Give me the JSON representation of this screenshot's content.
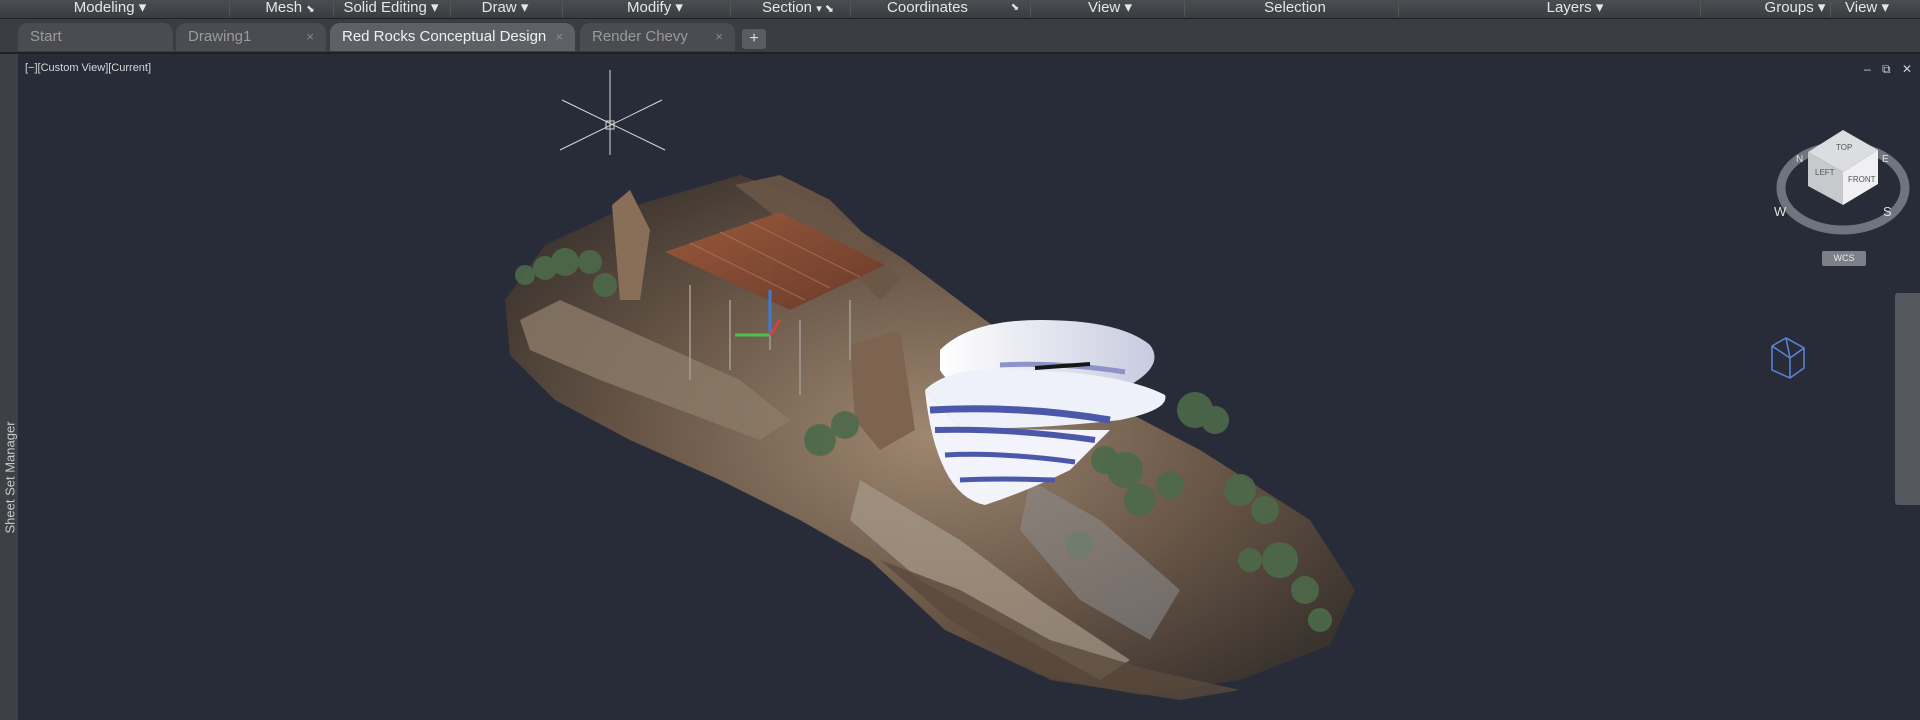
{
  "ribbon": [
    {
      "label": "Modeling",
      "arrow": "▾"
    },
    {
      "label": "Mesh",
      "arrow": "⬊"
    },
    {
      "label": "Solid Editing",
      "arrow": "▾"
    },
    {
      "label": "Draw",
      "arrow": "▾"
    },
    {
      "label": "Modify",
      "arrow": "▾"
    },
    {
      "label": "Section",
      "arrow": "▾ ⬊"
    },
    {
      "label": "Coordinates",
      "arrow": ""
    },
    {
      "label": "⬊",
      "arrow": ""
    },
    {
      "label": "View",
      "arrow": "▾"
    },
    {
      "label": "Selection",
      "arrow": ""
    },
    {
      "label": "Layers",
      "arrow": "▾"
    },
    {
      "label": "Groups",
      "arrow": "▾"
    },
    {
      "label": "View",
      "arrow": "▾"
    }
  ],
  "tabs": [
    {
      "label": "Start"
    },
    {
      "label": "Drawing1",
      "close": "×"
    },
    {
      "label": "Red Rocks Conceptual Design",
      "close": "×"
    },
    {
      "label": "Render Chevy",
      "close": "×"
    }
  ],
  "new_tab": "+",
  "left_palette": "Sheet Set Manager",
  "viewport_label": "[−][Custom View][Current]",
  "window_controls": {
    "minimize": "–",
    "restore": "⧉",
    "close": "✕"
  },
  "viewcube": {
    "top": "TOP",
    "left": "LEFT",
    "front": "FRONT",
    "n": "N",
    "w": "W",
    "s": "S",
    "e": "E"
  },
  "wcs": "WCS",
  "colors": {
    "background": "#282c38",
    "ribbon": "#3f4146",
    "active_tab": "#5e6066",
    "building": "#eef0fa",
    "building_stripe": "#4b57a8"
  }
}
